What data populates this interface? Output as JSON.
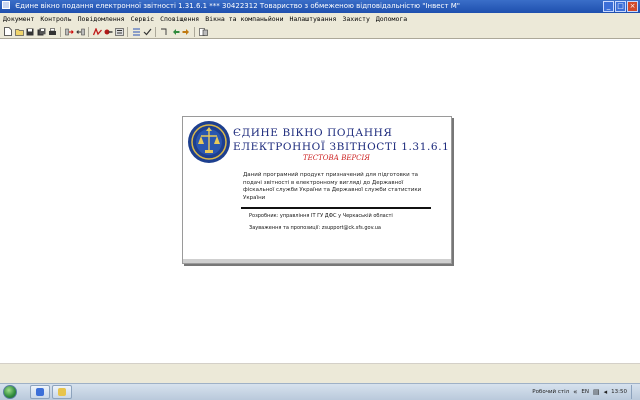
{
  "window": {
    "title": "Єдине вікно подання електронної звітності 1.31.6.1 *** 30422312 Товариство з обмеженою відповідальністю \"Інвест М\""
  },
  "menu": {
    "items": [
      "Документ",
      "Контроль",
      "Повідомлення",
      "Сервіс",
      "Сповіщення",
      "Вікна та компаньйони",
      "Налаштування",
      "Захисту",
      "Допомога"
    ]
  },
  "toolbar": {
    "icons": [
      "new-document-icon",
      "open-folder-icon",
      "save-icon",
      "save-all-icon",
      "print-icon",
      "send-icon",
      "receive-icon",
      "sign-icon",
      "encrypt-icon",
      "import-icon",
      "export-icon",
      "check-icon",
      "forward-icon",
      "back-icon",
      "refresh-icon",
      "help-icon"
    ]
  },
  "splash": {
    "heading_line1": "ЄДИНЕ ВІКНО ПОДАННЯ",
    "heading_line2": "ЕЛЕКТРОННОЇ ЗВІТНОСТІ 1.31.6.1",
    "test_label": "ТЕСТОВА ВЕРСІЯ",
    "description": "Даний програмний продукт призначений для підготовки та подачі звітності в електронному вигляді до Державної фіскальної служби України та Державної служби статистики України",
    "developer": "Розробник: управління ІТ ГУ ДФС у Черкаській області",
    "feedback": "Зауваження та пропозиції: zsupport@ck.sfs.gov.ua"
  },
  "taskbar": {
    "language": "EN",
    "tray_text": "Робочий стіл",
    "clock": "13:50"
  },
  "colors": {
    "titlebar": "#2556b8",
    "heading": "#1c2a7c",
    "test_label": "#cc1f1f"
  }
}
